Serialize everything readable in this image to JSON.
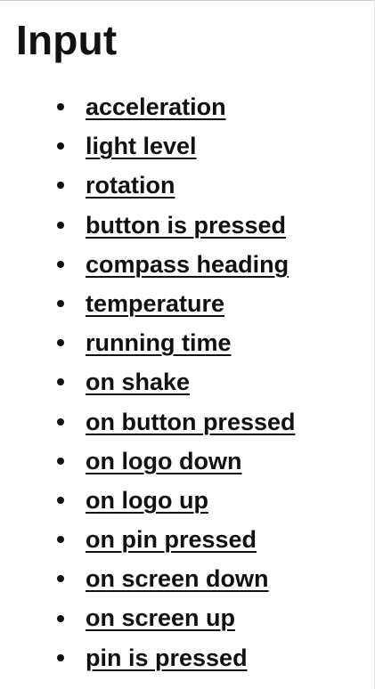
{
  "header": {
    "title": "Input"
  },
  "input_list": {
    "items": [
      {
        "label": "acceleration"
      },
      {
        "label": "light level"
      },
      {
        "label": "rotation"
      },
      {
        "label": "button is pressed"
      },
      {
        "label": "compass heading"
      },
      {
        "label": "temperature"
      },
      {
        "label": "running time"
      },
      {
        "label": "on shake"
      },
      {
        "label": "on button pressed"
      },
      {
        "label": "on logo down"
      },
      {
        "label": "on logo up"
      },
      {
        "label": "on pin pressed"
      },
      {
        "label": "on screen down"
      },
      {
        "label": "on screen up"
      },
      {
        "label": "pin is pressed"
      }
    ]
  }
}
